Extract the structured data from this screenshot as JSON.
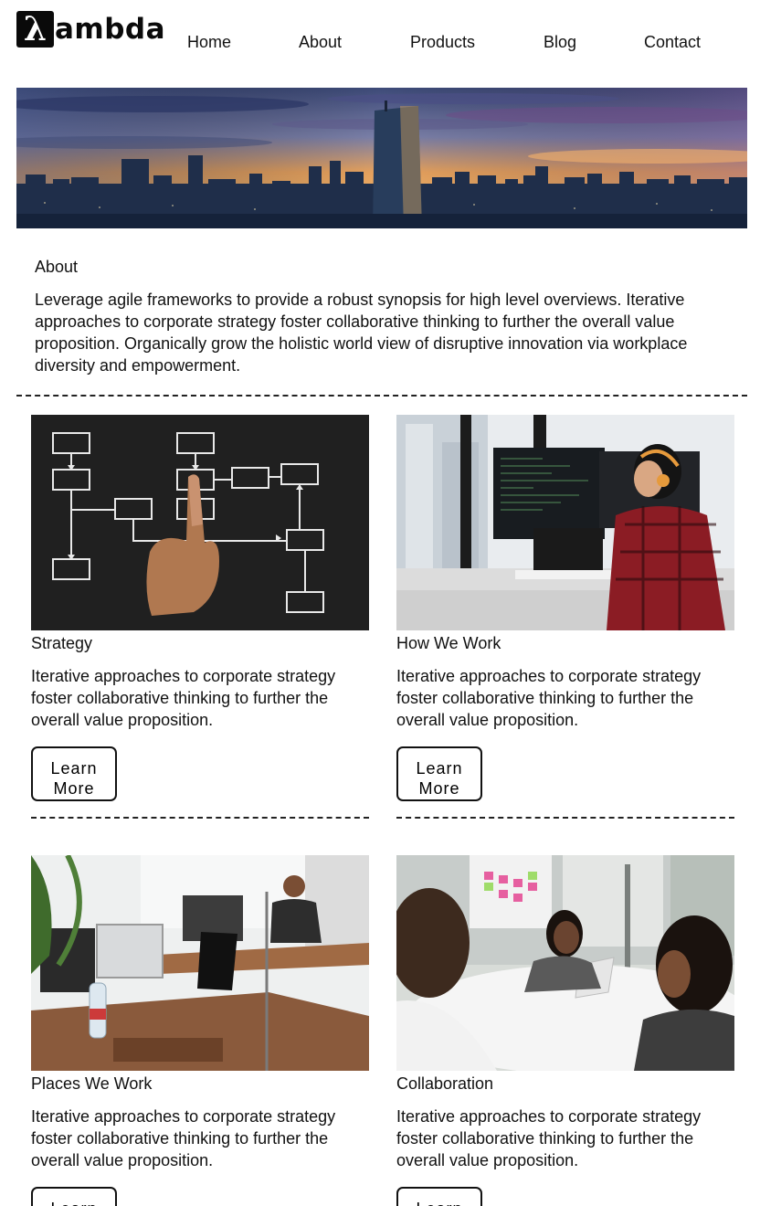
{
  "header": {
    "logo": {
      "symbol": "λ",
      "text": "ambda"
    },
    "nav": [
      "Home",
      "About",
      "Products",
      "Blog",
      "Contact"
    ]
  },
  "hero": {
    "image": "city-skyline-sunset"
  },
  "about": {
    "title": "About",
    "text": "Leverage agile frameworks to provide a robust synopsis for high level overviews. Iterative approaches to corporate strategy foster collaborative thinking to further the overall value proposition. Organically grow the holistic world view of disruptive innovation via workplace diversity and empowerment."
  },
  "cards": [
    {
      "title": "Strategy",
      "text": "Iterative approaches to corporate strategy foster collaborative thinking to further the overall value proposition.",
      "button": "Learn More",
      "image": "flowchart-chalkboard"
    },
    {
      "title": "How We Work",
      "text": "Iterative approaches to corporate strategy foster collaborative thinking to further the overall value proposition.",
      "button": "Learn More",
      "image": "developer-at-monitors"
    },
    {
      "title": "Places We Work",
      "text": "Iterative approaches to corporate strategy foster collaborative thinking to further the overall value proposition.",
      "button": "Learn More",
      "image": "office-desks"
    },
    {
      "title": "Collaboration",
      "text": "Iterative approaches to corporate strategy foster collaborative thinking to further the overall value proposition.",
      "button": "Learn More",
      "image": "team-meeting"
    }
  ],
  "colors": {
    "text": "#111111",
    "background": "#ffffff",
    "border": "#111111"
  }
}
